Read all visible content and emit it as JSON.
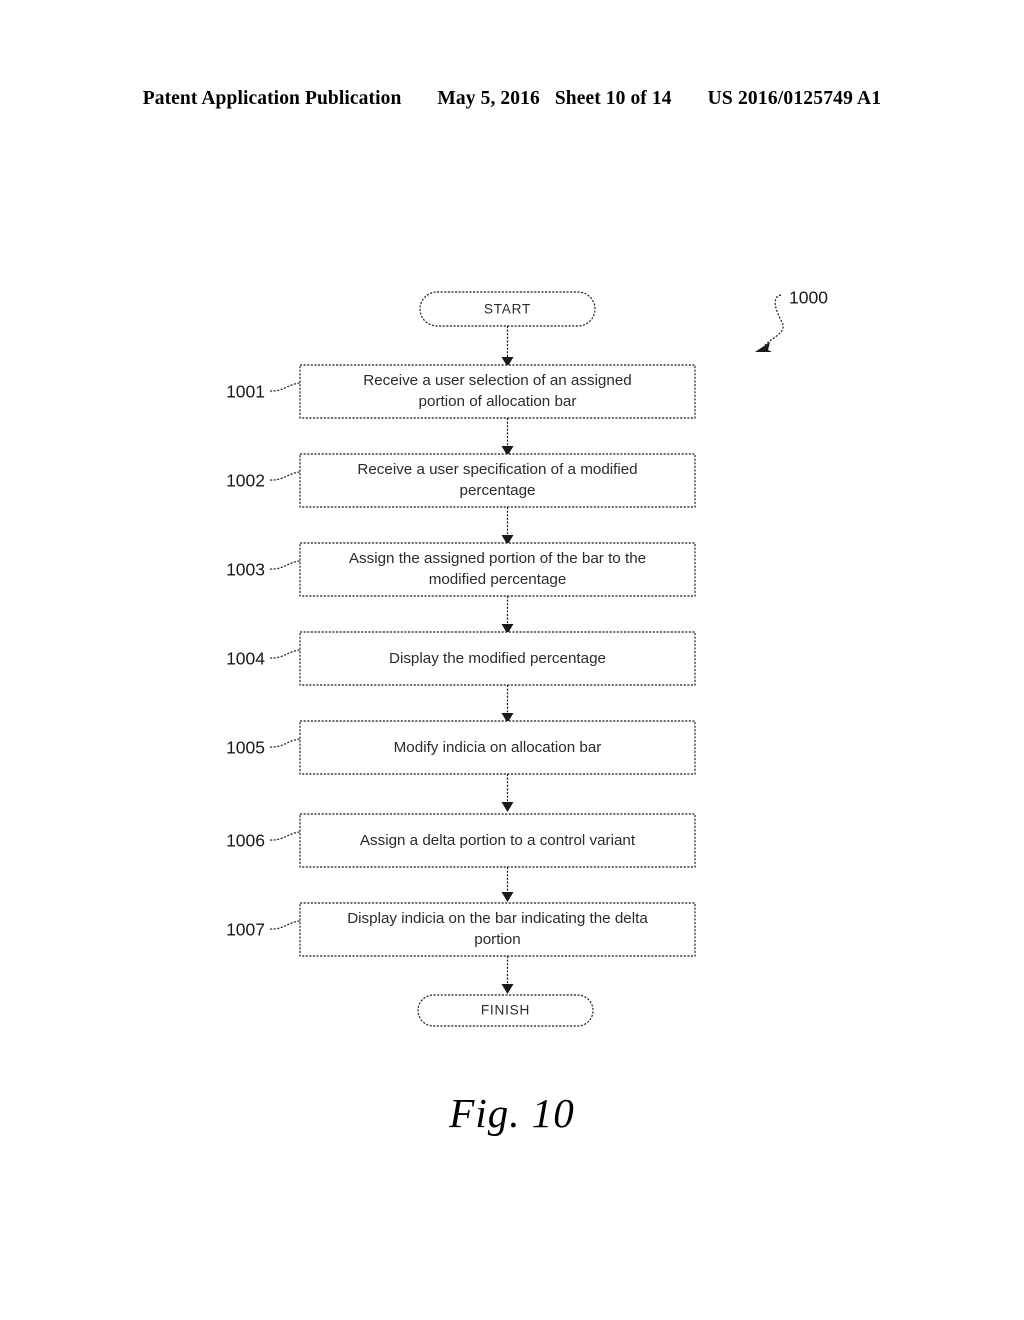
{
  "header": {
    "publication": "Patent Application Publication",
    "date": "May 5, 2016",
    "sheet": "Sheet 10 of 14",
    "patent_number": "US 2016/0125749 A1"
  },
  "figure": {
    "caption": "Fig. 10",
    "diagram_reference": "1000",
    "start_label": "START",
    "finish_label": "FINISH",
    "steps": [
      {
        "ref": "1001",
        "text": "Receive a user selection of an assigned portion of allocation bar",
        "lines": [
          "Receive a user selection of an assigned",
          "portion of allocation bar"
        ]
      },
      {
        "ref": "1002",
        "text": "Receive a user specification of a modified percentage",
        "lines": [
          "Receive a user specification of a modified",
          "percentage"
        ]
      },
      {
        "ref": "1003",
        "text": "Assign the assigned portion of the bar to the modified percentage",
        "lines": [
          "Assign the assigned portion of the bar to the",
          "modified percentage"
        ]
      },
      {
        "ref": "1004",
        "text": "Display the modified percentage",
        "lines": [
          "Display the modified percentage"
        ]
      },
      {
        "ref": "1005",
        "text": "Modify indicia on allocation bar",
        "lines": [
          "Modify indicia on allocation bar"
        ]
      },
      {
        "ref": "1006",
        "text": "Assign a delta portion to a control variant",
        "lines": [
          "Assign a delta portion to a control variant"
        ]
      },
      {
        "ref": "1007",
        "text": "Display indicia on the bar indicating the delta portion",
        "lines": [
          "Display indicia on the bar indicating the delta",
          "portion"
        ]
      }
    ]
  }
}
